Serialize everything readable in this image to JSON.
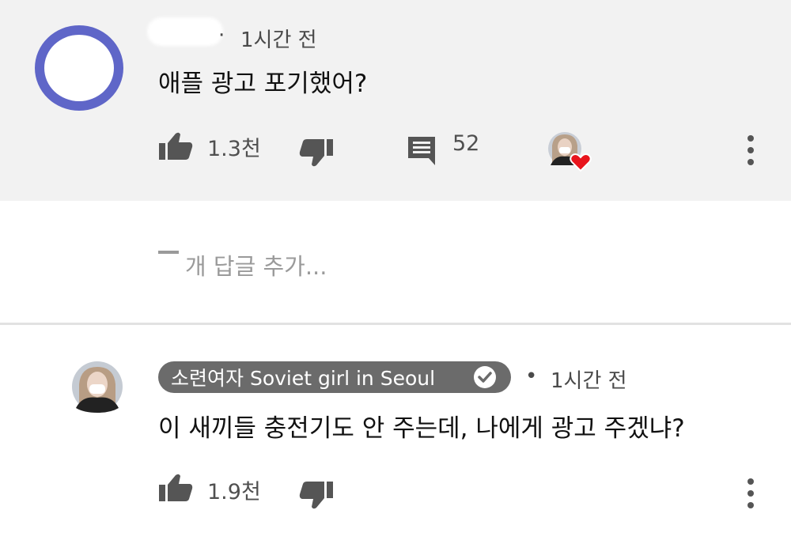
{
  "comment1": {
    "author": "",
    "separator": "·",
    "time": "1시간 전",
    "text": "애플 광고 포기했어?",
    "likes": "1.3천",
    "replies": "52",
    "icons": {
      "like": "thumbs-up-icon",
      "dislike": "thumbs-down-icon",
      "reply": "comment-icon",
      "creator_heart": "heart-icon",
      "more": "more-vertical-icon"
    }
  },
  "reply_box": {
    "placeholder": "개 답글 추가..."
  },
  "comment2": {
    "author": "소련여자 Soviet girl in Seoul",
    "verified": true,
    "separator": "•",
    "time": "1시간 전",
    "text": "이 새끼들 충전기도 안 주는데, 나에게 광고 주겠냐?",
    "likes": "1.9천"
  },
  "colors": {
    "top_background": "#f2f2f2",
    "avatar_ring": "#5f66c8",
    "channel_chip": "#6b6b6b",
    "heart": "#e8141c",
    "icon": "#555555"
  }
}
